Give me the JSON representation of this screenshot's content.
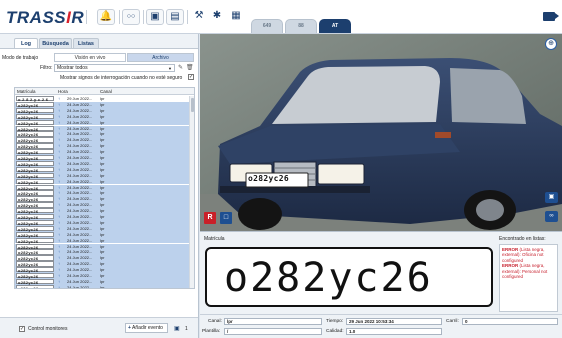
{
  "app": {
    "logo_text": "TRASSIR"
  },
  "toolbar": {
    "workspace_tabs": [
      "649",
      "88",
      "AT"
    ],
    "active_tab": "AT"
  },
  "left": {
    "tabs": [
      "Log",
      "Búsqueda",
      "Listas"
    ],
    "active_tab": "Log",
    "work_mode_label": "Modo de trabajo",
    "live_label": "Visión en vivo",
    "archive_label": "Archivo",
    "filter_label": "Filtro:",
    "filter_value": "Mostrar todos",
    "question_marks_label": "Mostrar signos de interrogación cuando no esté seguro",
    "table": {
      "headers": [
        "Matrícula",
        "Hora",
        "Canal"
      ],
      "rows": [
        {
          "plate": "o 2 8 2 y c 2 6",
          "time": "29 Jun 2022...",
          "channel": "lpr"
        },
        {
          "plate": "o282yc26",
          "time": "24 Jun 2022...",
          "channel": "lpr"
        },
        {
          "plate": "o282yc26",
          "time": "24 Jun 2022...",
          "channel": "lpr"
        },
        {
          "plate": "o282yc26",
          "time": "24 Jun 2022...",
          "channel": "lpr"
        },
        {
          "plate": "o282yc26",
          "time": "24 Jun 2022...",
          "channel": "lpr"
        },
        {
          "plate": "o282yc26",
          "time": "24 Jun 2022...",
          "channel": "lpr"
        },
        {
          "plate": "o282yc26",
          "time": "24 Jun 2022...",
          "channel": "lpr"
        },
        {
          "plate": "o282yc26",
          "time": "24 Jun 2022...",
          "channel": "lpr"
        },
        {
          "plate": "o282yc26",
          "time": "24 Jun 2022...",
          "channel": "lpr"
        },
        {
          "plate": "o282yc26",
          "time": "24 Jun 2022...",
          "channel": "lpr"
        },
        {
          "plate": "o282yc26",
          "time": "24 Jun 2022...",
          "channel": "lpr"
        },
        {
          "plate": "o282yc26",
          "time": "24 Jun 2022...",
          "channel": "lpr"
        },
        {
          "plate": "o282yc26",
          "time": "24 Jun 2022...",
          "channel": "lpr"
        },
        {
          "plate": "o282yc26",
          "time": "24 Jun 2022...",
          "channel": "lpr"
        },
        {
          "plate": "o282yc26",
          "time": "24 Jun 2022...",
          "channel": "lpr"
        },
        {
          "plate": "o282yc26",
          "time": "24 Jun 2022...",
          "channel": "lpr"
        },
        {
          "plate": "o282yc26",
          "time": "24 Jun 2022...",
          "channel": "lpr"
        },
        {
          "plate": "o282yc26",
          "time": "24 Jun 2022...",
          "channel": "lpr"
        },
        {
          "plate": "o282yc26",
          "time": "24 Jun 2022...",
          "channel": "lpr"
        },
        {
          "plate": "o282yc26",
          "time": "24 Jun 2022...",
          "channel": "lpr"
        },
        {
          "plate": "o282yc26",
          "time": "24 Jun 2022...",
          "channel": "lpr"
        },
        {
          "plate": "o282yc26",
          "time": "24 Jun 2022...",
          "channel": "lpr"
        },
        {
          "plate": "o282yc26",
          "time": "24 Jun 2022...",
          "channel": "lpr"
        },
        {
          "plate": "o282yc26",
          "time": "24 Jun 2022...",
          "channel": "lpr"
        },
        {
          "plate": "o282yc26",
          "time": "24 Jun 2022...",
          "channel": "lpr"
        },
        {
          "plate": "o282yc26",
          "time": "24 Jun 2022...",
          "channel": "lpr"
        },
        {
          "plate": "o282yc26",
          "time": "24 Jun 2022...",
          "channel": "lpr"
        },
        {
          "plate": "o282yc26",
          "time": "24 Jun 2022...",
          "channel": "lpr"
        },
        {
          "plate": "o282yc26",
          "time": "24 Jun 2022...",
          "channel": "lpr"
        },
        {
          "plate": "o282yc26",
          "time": "24 Jun 2022...",
          "channel": "lpr"
        },
        {
          "plate": "o282yc26",
          "time": "24 Jun 2022...",
          "channel": "lpr"
        },
        {
          "plate": "o282yc26",
          "time": "24 Jun 2022...",
          "channel": "lpr"
        },
        {
          "plate": "o282yc26",
          "time": "24 Jun 2022...",
          "channel": "lpr"
        }
      ]
    },
    "control_monitors_label": "Control monitores",
    "add_event_label": "Añadir evento",
    "count": "1"
  },
  "video": {
    "plate_on_car": "o282yc26",
    "rec_label": "R"
  },
  "recognition": {
    "matricula_label": "Matrícula",
    "plate_text": "o282yc26",
    "lists_label": "Encontrado en listas:",
    "list_errors": [
      {
        "tag": "ERROR",
        "text": " (Lista negra, external): Oficina not configured"
      },
      {
        "tag": "ERROR",
        "text": " (Lista negra, external): Personal not configured"
      }
    ]
  },
  "details": {
    "canal_label": "Canal:",
    "canal_value": "lpr",
    "tiempo_label": "Tiempo:",
    "tiempo_value": "29 Jun 2022 10:53:34",
    "carril_label": "Carril:",
    "carril_value": "0",
    "plantilla_label": "Plantilla:",
    "plantilla_value": "/",
    "calidad_label": "Calidad:",
    "calidad_value": "1.0"
  },
  "colors": {
    "brand": "#1c3f6e",
    "accent_red": "#d9232d",
    "selection": "#bcd1ec"
  },
  "icons": [
    "bell-icon",
    "link-icon",
    "monitor-icon",
    "layout-icon",
    "wrench-icon",
    "puzzle-icon",
    "chart-icon",
    "camera-icon",
    "zoom-icon",
    "pencil-icon",
    "trash-icon"
  ]
}
